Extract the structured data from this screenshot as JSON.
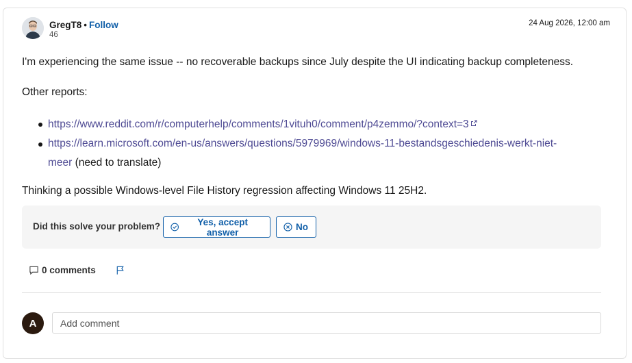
{
  "post": {
    "author": "GregT8",
    "separator": "•",
    "follow_label": "Follow",
    "reputation": "46",
    "timestamp": "24 Aug 2026, 12:00 am",
    "paragraph1": "I'm experiencing the same issue -- no recoverable backups since July despite the UI indicating backup completeness.",
    "paragraph2": "Other reports:",
    "links": [
      {
        "url": "https://www.reddit.com/r/computerhelp/comments/1vituh0/comment/p4zemmo/?context=3",
        "icon": "external-link-icon"
      },
      {
        "url_line1": "https://learn.microsoft.com/en-us/answers/questions/5979969/windows-11-bestandsgeschiedenis-werkt-niet-",
        "url_line2": "meer",
        "note": " (need to translate)"
      }
    ],
    "paragraph3": "Thinking a possible Windows-level File History regression affecting Windows 11 25H2."
  },
  "feedback": {
    "question": "Did this solve your problem?",
    "yes_label": "Yes, accept answer",
    "no_label": "No"
  },
  "actions": {
    "comments_label": "0 comments",
    "flag_icon": "flag-icon"
  },
  "composer": {
    "avatar_initial": "A",
    "placeholder": "Add comment"
  },
  "colors": {
    "link": "#4f4b94",
    "accent": "#0f5ea8",
    "avatar": "#2b1a0f"
  }
}
